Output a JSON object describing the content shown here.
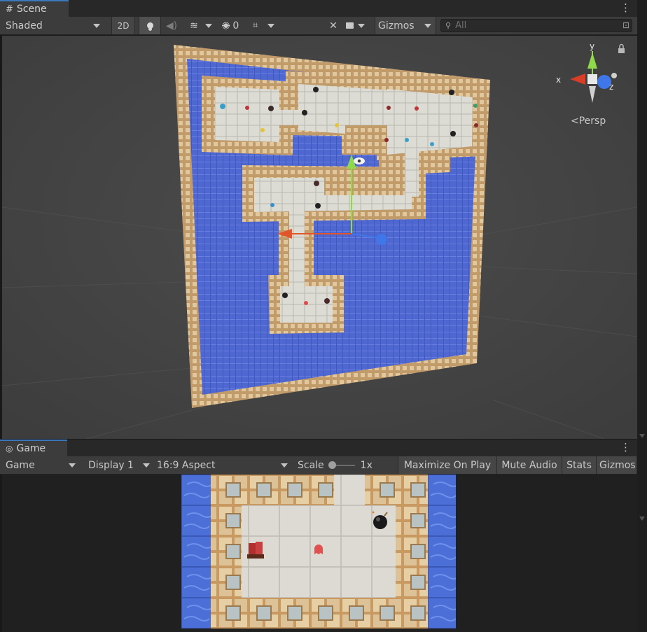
{
  "scene": {
    "tab_label": "Scene",
    "shading_mode": "Shaded",
    "btn_2d": "2D",
    "hidden_count": "0",
    "gizmos_label": "Gizmos",
    "search_placeholder": "All",
    "persp_label": "Persp",
    "axis_x": "x",
    "axis_y": "y",
    "axis_z": "z"
  },
  "game": {
    "tab_label": "Game",
    "view_mode": "Game",
    "display": "Display 1",
    "aspect": "16:9 Aspect",
    "scale_label": "Scale",
    "scale_value": "1x",
    "maximize_label": "Maximize On Play",
    "mute_label": "Mute Audio",
    "stats_label": "Stats",
    "gizmos_label": "Gizmos"
  },
  "colors": {
    "water": "#5169d6",
    "floor": "#dcdcd6",
    "wall": "#c9a679",
    "accent_tab": "#3a79bb"
  }
}
